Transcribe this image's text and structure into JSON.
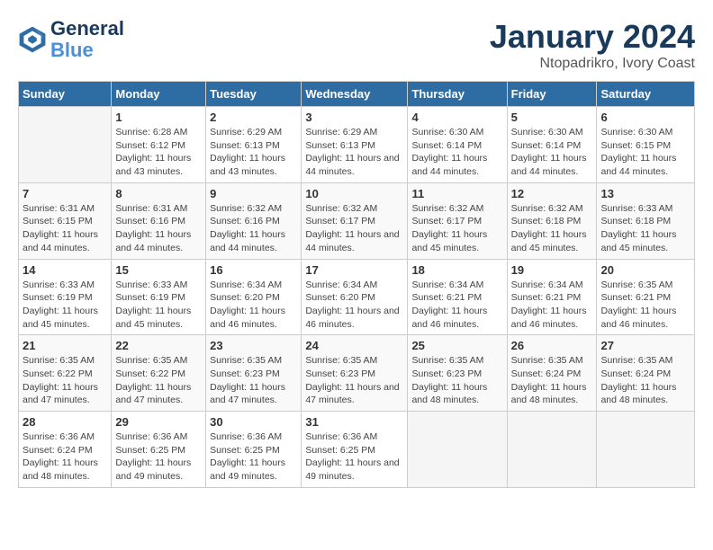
{
  "logo": {
    "line1": "General",
    "line2": "Blue"
  },
  "title": "January 2024",
  "subtitle": "Ntopadrikro, Ivory Coast",
  "header": {
    "days": [
      "Sunday",
      "Monday",
      "Tuesday",
      "Wednesday",
      "Thursday",
      "Friday",
      "Saturday"
    ]
  },
  "rows": [
    [
      {
        "date": "",
        "sunrise": "",
        "sunset": "",
        "daylight": "",
        "empty": true
      },
      {
        "date": "1",
        "sunrise": "Sunrise: 6:28 AM",
        "sunset": "Sunset: 6:12 PM",
        "daylight": "Daylight: 11 hours and 43 minutes."
      },
      {
        "date": "2",
        "sunrise": "Sunrise: 6:29 AM",
        "sunset": "Sunset: 6:13 PM",
        "daylight": "Daylight: 11 hours and 43 minutes."
      },
      {
        "date": "3",
        "sunrise": "Sunrise: 6:29 AM",
        "sunset": "Sunset: 6:13 PM",
        "daylight": "Daylight: 11 hours and 44 minutes."
      },
      {
        "date": "4",
        "sunrise": "Sunrise: 6:30 AM",
        "sunset": "Sunset: 6:14 PM",
        "daylight": "Daylight: 11 hours and 44 minutes."
      },
      {
        "date": "5",
        "sunrise": "Sunrise: 6:30 AM",
        "sunset": "Sunset: 6:14 PM",
        "daylight": "Daylight: 11 hours and 44 minutes."
      },
      {
        "date": "6",
        "sunrise": "Sunrise: 6:30 AM",
        "sunset": "Sunset: 6:15 PM",
        "daylight": "Daylight: 11 hours and 44 minutes."
      }
    ],
    [
      {
        "date": "7",
        "sunrise": "Sunrise: 6:31 AM",
        "sunset": "Sunset: 6:15 PM",
        "daylight": "Daylight: 11 hours and 44 minutes."
      },
      {
        "date": "8",
        "sunrise": "Sunrise: 6:31 AM",
        "sunset": "Sunset: 6:16 PM",
        "daylight": "Daylight: 11 hours and 44 minutes."
      },
      {
        "date": "9",
        "sunrise": "Sunrise: 6:32 AM",
        "sunset": "Sunset: 6:16 PM",
        "daylight": "Daylight: 11 hours and 44 minutes."
      },
      {
        "date": "10",
        "sunrise": "Sunrise: 6:32 AM",
        "sunset": "Sunset: 6:17 PM",
        "daylight": "Daylight: 11 hours and 44 minutes."
      },
      {
        "date": "11",
        "sunrise": "Sunrise: 6:32 AM",
        "sunset": "Sunset: 6:17 PM",
        "daylight": "Daylight: 11 hours and 45 minutes."
      },
      {
        "date": "12",
        "sunrise": "Sunrise: 6:32 AM",
        "sunset": "Sunset: 6:18 PM",
        "daylight": "Daylight: 11 hours and 45 minutes."
      },
      {
        "date": "13",
        "sunrise": "Sunrise: 6:33 AM",
        "sunset": "Sunset: 6:18 PM",
        "daylight": "Daylight: 11 hours and 45 minutes."
      }
    ],
    [
      {
        "date": "14",
        "sunrise": "Sunrise: 6:33 AM",
        "sunset": "Sunset: 6:19 PM",
        "daylight": "Daylight: 11 hours and 45 minutes."
      },
      {
        "date": "15",
        "sunrise": "Sunrise: 6:33 AM",
        "sunset": "Sunset: 6:19 PM",
        "daylight": "Daylight: 11 hours and 45 minutes."
      },
      {
        "date": "16",
        "sunrise": "Sunrise: 6:34 AM",
        "sunset": "Sunset: 6:20 PM",
        "daylight": "Daylight: 11 hours and 46 minutes."
      },
      {
        "date": "17",
        "sunrise": "Sunrise: 6:34 AM",
        "sunset": "Sunset: 6:20 PM",
        "daylight": "Daylight: 11 hours and 46 minutes."
      },
      {
        "date": "18",
        "sunrise": "Sunrise: 6:34 AM",
        "sunset": "Sunset: 6:21 PM",
        "daylight": "Daylight: 11 hours and 46 minutes."
      },
      {
        "date": "19",
        "sunrise": "Sunrise: 6:34 AM",
        "sunset": "Sunset: 6:21 PM",
        "daylight": "Daylight: 11 hours and 46 minutes."
      },
      {
        "date": "20",
        "sunrise": "Sunrise: 6:35 AM",
        "sunset": "Sunset: 6:21 PM",
        "daylight": "Daylight: 11 hours and 46 minutes."
      }
    ],
    [
      {
        "date": "21",
        "sunrise": "Sunrise: 6:35 AM",
        "sunset": "Sunset: 6:22 PM",
        "daylight": "Daylight: 11 hours and 47 minutes."
      },
      {
        "date": "22",
        "sunrise": "Sunrise: 6:35 AM",
        "sunset": "Sunset: 6:22 PM",
        "daylight": "Daylight: 11 hours and 47 minutes."
      },
      {
        "date": "23",
        "sunrise": "Sunrise: 6:35 AM",
        "sunset": "Sunset: 6:23 PM",
        "daylight": "Daylight: 11 hours and 47 minutes."
      },
      {
        "date": "24",
        "sunrise": "Sunrise: 6:35 AM",
        "sunset": "Sunset: 6:23 PM",
        "daylight": "Daylight: 11 hours and 47 minutes."
      },
      {
        "date": "25",
        "sunrise": "Sunrise: 6:35 AM",
        "sunset": "Sunset: 6:23 PM",
        "daylight": "Daylight: 11 hours and 48 minutes."
      },
      {
        "date": "26",
        "sunrise": "Sunrise: 6:35 AM",
        "sunset": "Sunset: 6:24 PM",
        "daylight": "Daylight: 11 hours and 48 minutes."
      },
      {
        "date": "27",
        "sunrise": "Sunrise: 6:35 AM",
        "sunset": "Sunset: 6:24 PM",
        "daylight": "Daylight: 11 hours and 48 minutes."
      }
    ],
    [
      {
        "date": "28",
        "sunrise": "Sunrise: 6:36 AM",
        "sunset": "Sunset: 6:24 PM",
        "daylight": "Daylight: 11 hours and 48 minutes."
      },
      {
        "date": "29",
        "sunrise": "Sunrise: 6:36 AM",
        "sunset": "Sunset: 6:25 PM",
        "daylight": "Daylight: 11 hours and 49 minutes."
      },
      {
        "date": "30",
        "sunrise": "Sunrise: 6:36 AM",
        "sunset": "Sunset: 6:25 PM",
        "daylight": "Daylight: 11 hours and 49 minutes."
      },
      {
        "date": "31",
        "sunrise": "Sunrise: 6:36 AM",
        "sunset": "Sunset: 6:25 PM",
        "daylight": "Daylight: 11 hours and 49 minutes."
      },
      {
        "date": "",
        "sunrise": "",
        "sunset": "",
        "daylight": "",
        "empty": true
      },
      {
        "date": "",
        "sunrise": "",
        "sunset": "",
        "daylight": "",
        "empty": true
      },
      {
        "date": "",
        "sunrise": "",
        "sunset": "",
        "daylight": "",
        "empty": true
      }
    ]
  ]
}
